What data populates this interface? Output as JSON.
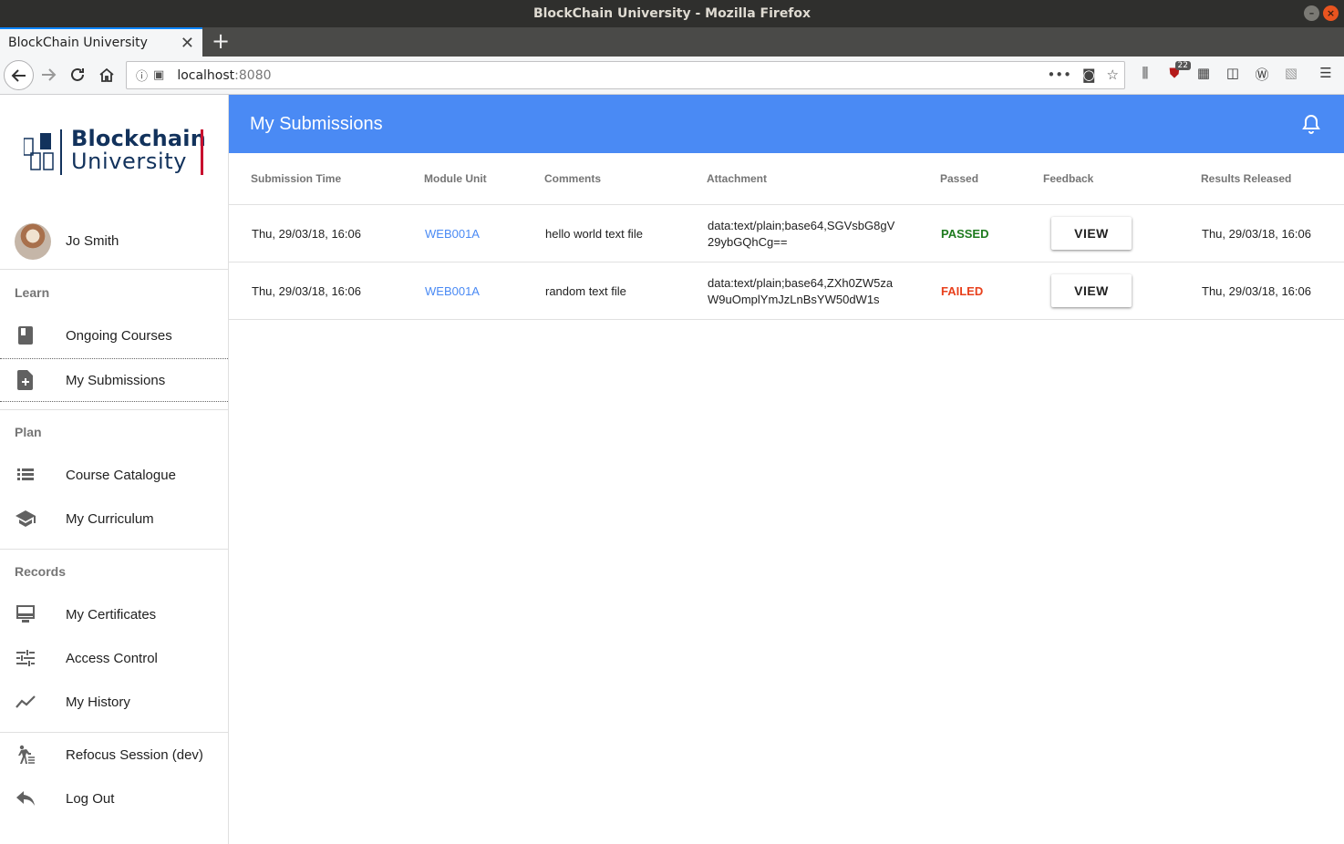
{
  "window": {
    "title": "BlockChain University - Mozilla Firefox"
  },
  "browser": {
    "tab_title": "BlockChain University",
    "url_host": "localhost",
    "url_port": ":8080",
    "badge_count": "22"
  },
  "logo": {
    "line1": "Blockchain",
    "line2": "University"
  },
  "user": {
    "name": "Jo Smith"
  },
  "sidebar": {
    "sections": {
      "learn": "Learn",
      "plan": "Plan",
      "records": "Records"
    },
    "items": {
      "ongoing_courses": "Ongoing Courses",
      "my_submissions": "My Submissions",
      "course_catalogue": "Course Catalogue",
      "my_curriculum": "My Curriculum",
      "my_certificates": "My Certificates",
      "access_control": "Access Control",
      "my_history": "My History",
      "refocus_session": "Refocus Session (dev)",
      "log_out": "Log Out"
    }
  },
  "page": {
    "title": "My Submissions"
  },
  "table": {
    "headers": {
      "submission_time": "Submission Time",
      "module_unit": "Module Unit",
      "comments": "Comments",
      "attachment": "Attachment",
      "passed": "Passed",
      "feedback": "Feedback",
      "results_released": "Results Released"
    },
    "rows": [
      {
        "submission_time": "Thu, 29/03/18, 16:06",
        "module_unit": "WEB001A",
        "comments": "hello world text file",
        "attachment": "data:text/plain;base64,SGVsbG8gV29ybGQhCg==",
        "status": "PASSED",
        "feedback_label": "VIEW",
        "results_released": "Thu, 29/03/18, 16:06"
      },
      {
        "submission_time": "Thu, 29/03/18, 16:06",
        "module_unit": "WEB001A",
        "comments": "random text file",
        "attachment": "data:text/plain;base64,ZXh0ZW5zaW9uOmplYmJzLnBsYW50dW1s",
        "status": "FAILED",
        "feedback_label": "VIEW",
        "results_released": "Thu, 29/03/18, 16:06"
      }
    ]
  },
  "colors": {
    "app_bar": "#4a8af4",
    "link": "#4a8af4",
    "passed": "#1e7b1e",
    "failed": "#e8401c",
    "logo_navy": "#12325c",
    "logo_red": "#c8102e"
  }
}
